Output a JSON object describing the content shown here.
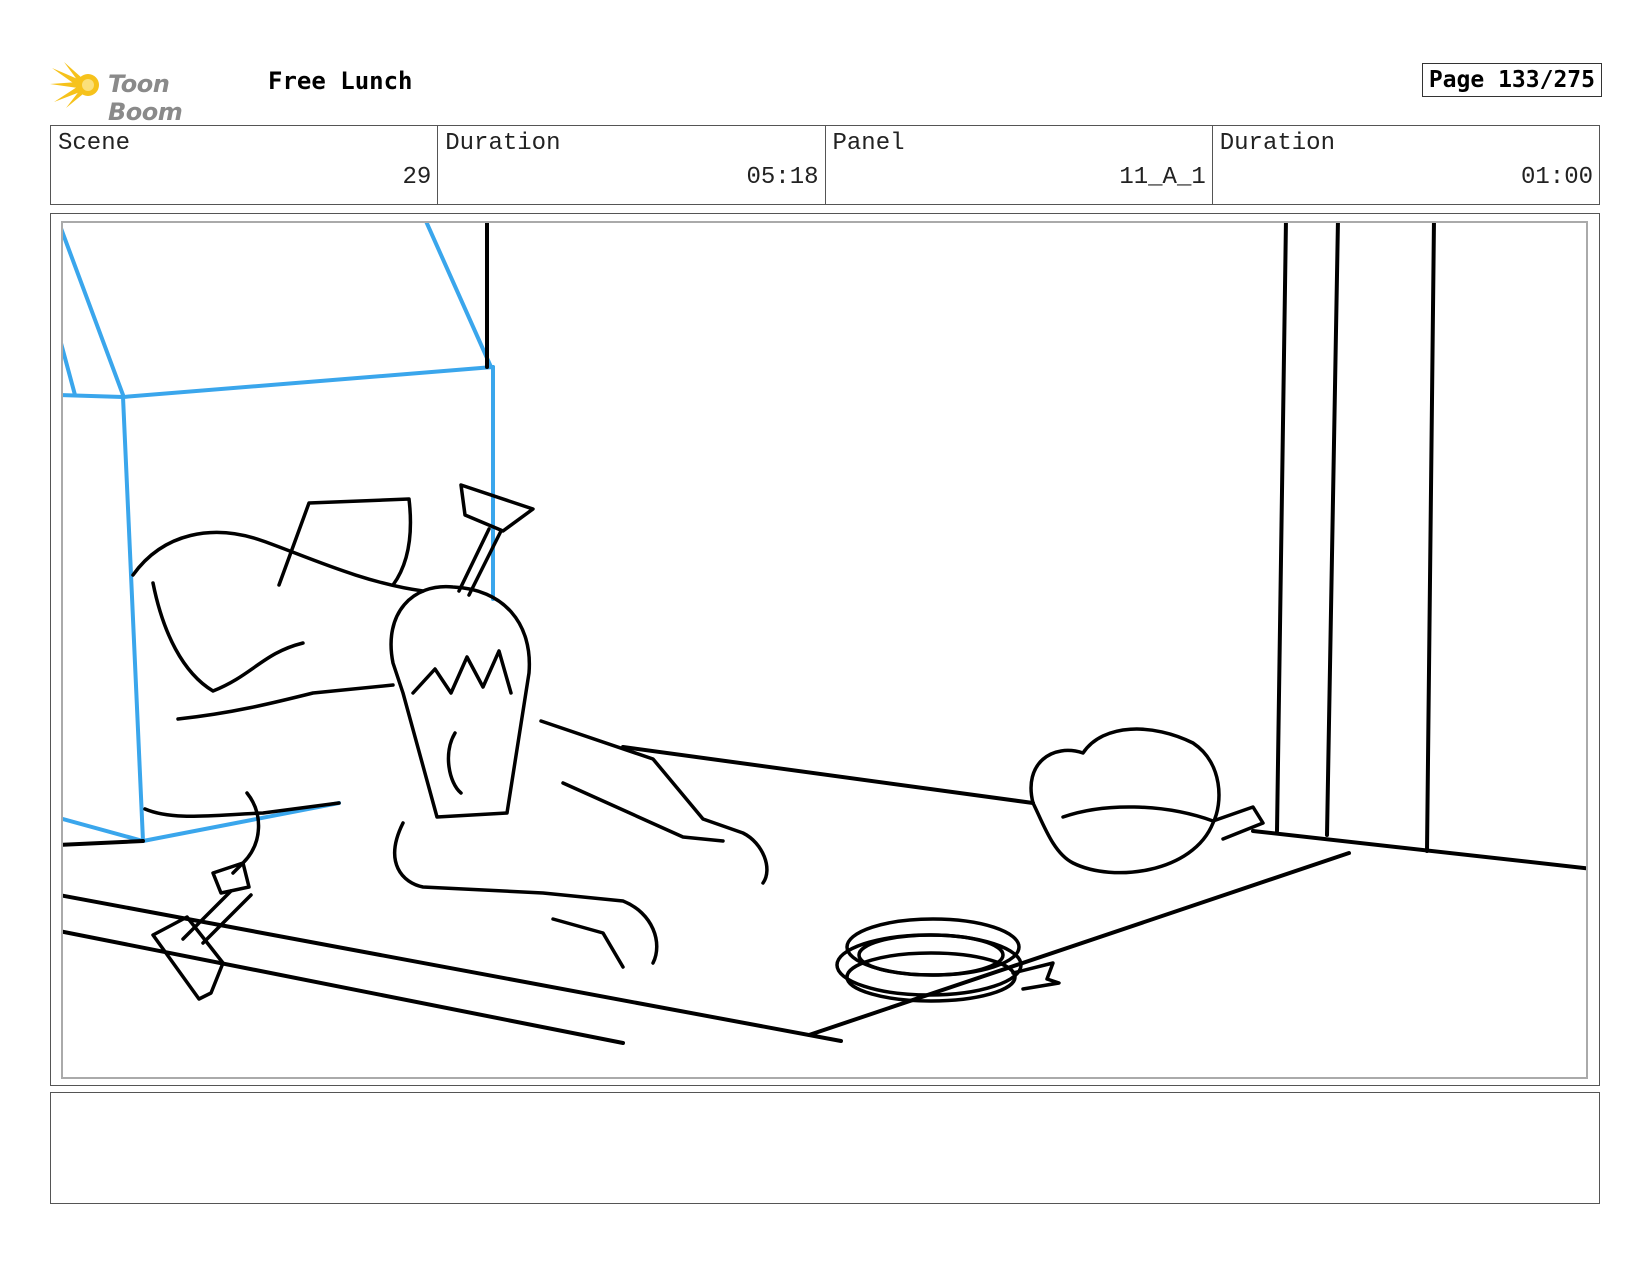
{
  "header": {
    "logo_text": "Toon Boom",
    "project_title": "Free Lunch",
    "page_label": "Page 133/275"
  },
  "info": {
    "scene_label": "Scene",
    "scene_value": "29",
    "scene_duration_label": "Duration",
    "scene_duration_value": "05:18",
    "panel_label": "Panel",
    "panel_value": "11_A_1",
    "panel_duration_label": "Duration",
    "panel_duration_value": "01:00"
  },
  "notes": {
    "text": ""
  },
  "colors": {
    "sketch_blue": "#3aa6ec",
    "sketch_black": "#000000",
    "logo_yellow": "#f6c21b",
    "logo_gray": "#8a8a8a"
  }
}
